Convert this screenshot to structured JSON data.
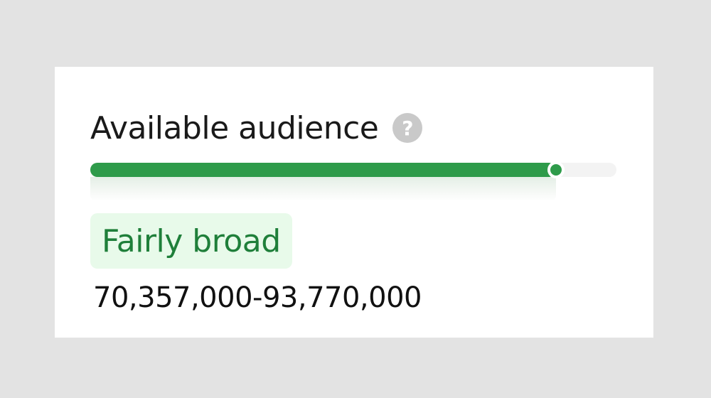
{
  "audience": {
    "title": "Available audience",
    "help_icon": "question-circle-icon",
    "meter_fraction": 0.885,
    "status_label": "Fairly broad",
    "range_text": "70,357,000-93,770,000"
  },
  "colors": {
    "background": "#e3e3e3",
    "card": "#ffffff",
    "meter_fill": "#2e9b4a",
    "meter_track": "#f3f3f3",
    "badge_bg": "#e8faea",
    "badge_text": "#1f7f3a",
    "help_icon": "#c9c9c9"
  }
}
